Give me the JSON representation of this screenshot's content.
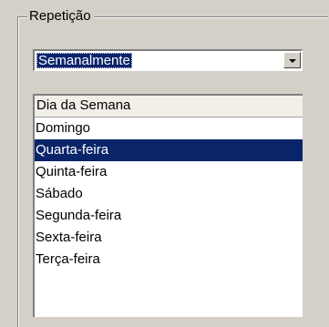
{
  "group": {
    "title": "Repetição"
  },
  "combo": {
    "value": "Semanalmente",
    "icon": "chevron-down-icon"
  },
  "list": {
    "header": "Dia da Semana",
    "items": [
      {
        "label": "Domingo",
        "selected": false
      },
      {
        "label": "Quarta-feira",
        "selected": true
      },
      {
        "label": "Quinta-feira",
        "selected": false
      },
      {
        "label": "Sábado",
        "selected": false
      },
      {
        "label": "Segunda-feira",
        "selected": false
      },
      {
        "label": "Sexta-feira",
        "selected": false
      },
      {
        "label": "Terça-feira",
        "selected": false
      }
    ]
  },
  "colors": {
    "selection": "#0a246a",
    "window": "#d4d0c8"
  }
}
